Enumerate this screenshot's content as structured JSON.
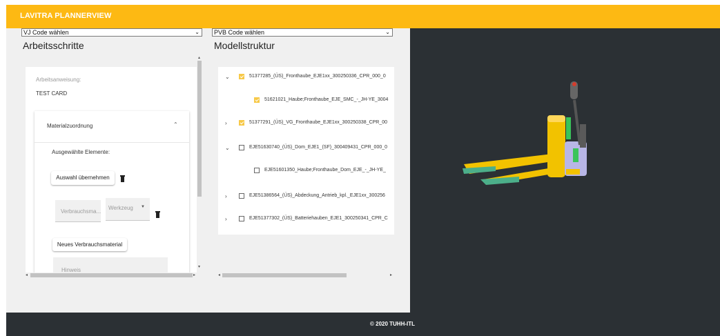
{
  "app": {
    "title": "LAVITRA PLANNERVIEW",
    "footer": "© 2020 TUHH-ITL"
  },
  "selects": {
    "vj": {
      "value": "VJ Code wählen"
    },
    "pvb": {
      "value": "PVB Code wählen"
    }
  },
  "left": {
    "title": "Arbeitsschritte",
    "instruction_label": "Arbeitsanweisung:",
    "instruction_value": "TEST CARD",
    "material": {
      "header": "Materialzuordnung",
      "selected_label": "Ausgewählte Elemente:",
      "apply_button": "Auswahl übernehmen",
      "consumable_placeholder": "Verbrauchsma...",
      "tool_label": "Werkzeug",
      "new_button": "Neues Verbrauchsmaterial",
      "hint_placeholder": "Hinweis"
    }
  },
  "right": {
    "title": "Modellstruktur",
    "tree": [
      {
        "label": "51377285_(ÜS)_Fronthaube_EJE1xx_300250336_CPR_000_0",
        "toggle": "expanded",
        "checked": true,
        "indent": 0
      },
      {
        "label": "51621021_Haube;Fronthaube_EJE_SMC_-_JH-YE_3004",
        "toggle": "none",
        "checked": true,
        "indent": 1
      },
      {
        "label": "51377291_(ÜS)_VG_Fronthaube_EJE1xx_300250338_CPR_00",
        "toggle": "collapsed",
        "checked": true,
        "indent": 0
      },
      {
        "label": "EJE51630740_(ÜS)_Dom_EJE1_(SF)_300409431_CPR_000_0",
        "toggle": "expanded",
        "checked": false,
        "indent": 0
      },
      {
        "label": "EJE51601350_Haube;Fronthaube_Dom_EJE_-_JH-YE_",
        "toggle": "none",
        "checked": false,
        "indent": 1
      },
      {
        "label": "EJE51386564_(ÜS)_Abdeckung_Antrieb_kpl._EJE1xx_300256",
        "toggle": "collapsed",
        "checked": false,
        "indent": 0
      },
      {
        "label": "EJE51377302_(ÜS)_Batteriehauben_EJE1_300250341_CPR_C",
        "toggle": "collapsed",
        "checked": false,
        "indent": 0
      }
    ]
  },
  "colors": {
    "accent": "#fdb913",
    "dark": "#2b3034",
    "checkbox": "#f7c948"
  }
}
